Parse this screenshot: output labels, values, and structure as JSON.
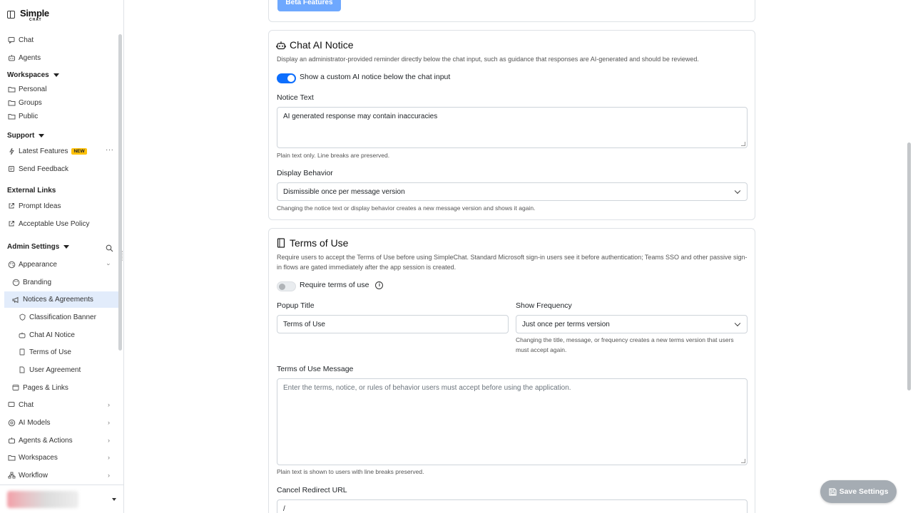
{
  "app": {
    "logo_main": "Simple",
    "logo_sub": "CHAT"
  },
  "sidebar": {
    "chat": "Chat",
    "agents": "Agents",
    "workspaces_header": "Workspaces",
    "personal": "Personal",
    "groups": "Groups",
    "public": "Public",
    "support_header": "Support",
    "latest_features": "Latest Features",
    "new_badge": "NEW",
    "send_feedback": "Send Feedback",
    "external_links_header": "External Links",
    "prompt_ideas": "Prompt Ideas",
    "acceptable_use": "Acceptable Use Policy",
    "admin_settings_header": "Admin Settings",
    "appearance": "Appearance",
    "branding": "Branding",
    "notices": "Notices & Agreements",
    "classification_banner": "Classification Banner",
    "chat_ai_notice": "Chat AI Notice",
    "terms_of_use": "Terms of Use",
    "user_agreement": "User Agreement",
    "pages_links": "Pages & Links",
    "chat_settings": "Chat",
    "ai_models": "AI Models",
    "agents_actions": "Agents & Actions",
    "workspaces_settings": "Workspaces",
    "workflow": "Workflow"
  },
  "top_card": {
    "beta_button": "Beta Features"
  },
  "ai_notice": {
    "title": "Chat AI Notice",
    "description": "Display an administrator-provided reminder directly below the chat input, such as guidance that responses are AI-generated and should be reviewed.",
    "toggle_label": "Show a custom AI notice below the chat input",
    "toggle_on": true,
    "notice_text_label": "Notice Text",
    "notice_text_value": "AI generated response may contain inaccuracies",
    "notice_text_help": "Plain text only. Line breaks are preserved.",
    "display_behavior_label": "Display Behavior",
    "display_behavior_value": "Dismissible once per message version",
    "display_behavior_help": "Changing the notice text or display behavior creates a new message version and shows it again."
  },
  "terms": {
    "title": "Terms of Use",
    "description": "Require users to accept the Terms of Use before using SimpleChat. Standard Microsoft sign-in users see it before authentication; Teams SSO and other passive sign-in flows are gated immediately after the app session is created.",
    "toggle_label": "Require terms of use",
    "toggle_on": false,
    "popup_title_label": "Popup Title",
    "popup_title_value": "Terms of Use",
    "show_frequency_label": "Show Frequency",
    "show_frequency_value": "Just once per terms version",
    "show_frequency_help": "Changing the title, message, or frequency creates a new terms version that users must accept again.",
    "message_label": "Terms of Use Message",
    "message_placeholder": "Enter the terms, notice, or rules of behavior users must accept before using the application.",
    "message_help": "Plain text is shown to users with line breaks preserved.",
    "cancel_redirect_label": "Cancel Redirect URL",
    "cancel_redirect_value": "/"
  },
  "actions": {
    "save_settings": "Save Settings"
  },
  "colors": {
    "primary": "#0d6efd",
    "active_nav_bg": "#e2ecfb",
    "new_badge": "#ffc107",
    "save_button": "#a5acb3"
  }
}
